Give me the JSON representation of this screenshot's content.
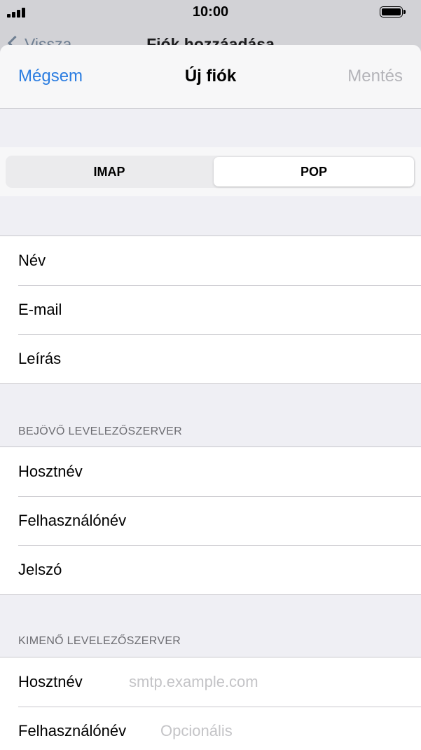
{
  "status_bar": {
    "time": "10:00"
  },
  "background_nav": {
    "back_label": "Vissza",
    "title": "Fiók hozzáadása"
  },
  "sheet_nav": {
    "cancel_label": "Mégsem",
    "title": "Új fiók",
    "save_label": "Mentés"
  },
  "account_type": {
    "options": [
      "IMAP",
      "POP"
    ],
    "selected": "POP"
  },
  "account_info": {
    "rows": [
      {
        "label": "Név"
      },
      {
        "label": "E-mail"
      },
      {
        "label": "Leírás"
      }
    ]
  },
  "incoming_server": {
    "header": "BEJÖVŐ LEVELEZŐSZERVER",
    "rows": [
      {
        "label": "Hosztnév"
      },
      {
        "label": "Felhasználónév"
      },
      {
        "label": "Jelszó"
      }
    ]
  },
  "outgoing_server": {
    "header": "KIMENŐ LEVELEZŐSZERVER",
    "rows": [
      {
        "label": "Hosztnév",
        "placeholder": "smtp.example.com"
      },
      {
        "label": "Felhasználónév",
        "placeholder": "Opcionális"
      }
    ]
  },
  "colors": {
    "accent": "#2b7de1",
    "disabled": "#b4b4b9",
    "placeholder": "#c4c4c7",
    "grouped_background": "#efeff4"
  },
  "icons": {
    "signal": "cellular-signal-icon",
    "battery": "battery-icon",
    "back": "chevron-left-icon"
  }
}
